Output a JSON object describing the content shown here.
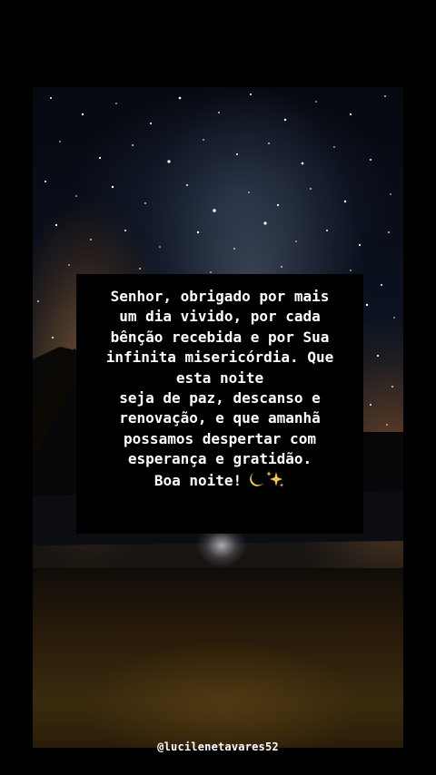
{
  "post": {
    "message_body": "Senhor, obrigado por mais\num dia vivido, por cada\nbênção recebida e por Sua\ninfinita misericórdia. Que\nesta noite\nseja de paz, descanso e\nrenovação, e que amanhã\npossamos despertar com\nesperança e gratidão.",
    "closing": "Boa noite!",
    "closing_emojis": [
      "moon-icon",
      "sparkles-icon"
    ],
    "username": "@lucilenetavares52"
  },
  "colors": {
    "background": "#000000",
    "text": "#ffffff",
    "text_box": "#000000",
    "moon": "#f2c94c",
    "sparkles": "#f5c542"
  }
}
